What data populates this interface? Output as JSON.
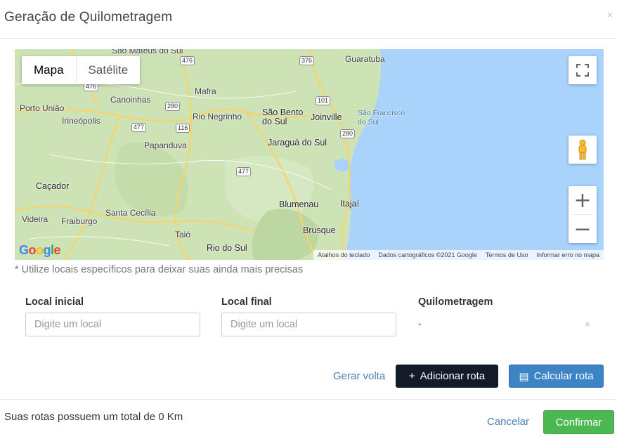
{
  "modal": {
    "title": "Geração de Quilometragem",
    "close_glyph": "×"
  },
  "map": {
    "type_buttons": {
      "map": "Mapa",
      "satellite": "Satélite"
    },
    "zoom_in": "+",
    "zoom_out": "−",
    "logo": "Google",
    "attribution": [
      "Atalhos do teclado",
      "Dados cartográficos ©2021 Google",
      "Termos de Uso",
      "Informar erro no mapa"
    ],
    "places": [
      "São Mateus do Sul",
      "Guaratuba",
      "Mafra",
      "Canoinhas",
      "Porto União",
      "Irineópolis",
      "Rio Negrinho",
      "São Bento do Sul",
      "Joinville",
      "São Francisco do Sul",
      "Papanduva",
      "Jaraguá do Sul",
      "Caçador",
      "Blumenau",
      "Itajaí",
      "Santa Cecília",
      "Videira",
      "Fraiburgo",
      "Brusque",
      "Taió",
      "Rio do Sul"
    ],
    "roads": [
      "476",
      "376",
      "476",
      "280",
      "101",
      "116",
      "477",
      "280",
      "477"
    ],
    "colors": {
      "land": "#cde3b6",
      "sea": "#a9d3fb",
      "road": "#f6d36b"
    }
  },
  "hint": "* Utilize locais específicos para deixar suas ainda mais precisas",
  "route_form": {
    "start_label": "Local inicial",
    "start_placeholder": "Digite um local",
    "end_label": "Local final",
    "end_placeholder": "Digite um local",
    "km_label": "Quilometragem",
    "km_value": "-",
    "remove_glyph": "×"
  },
  "actions": {
    "return_link": "Gerar volta",
    "add_route": "Adicionar rota",
    "add_icon": "+",
    "calc_route": "Calcular rota",
    "calc_icon": "▤"
  },
  "footer": {
    "total_text": "Suas rotas possuem um total de 0 Km",
    "cancel": "Cancelar",
    "confirm": "Confirmar"
  }
}
